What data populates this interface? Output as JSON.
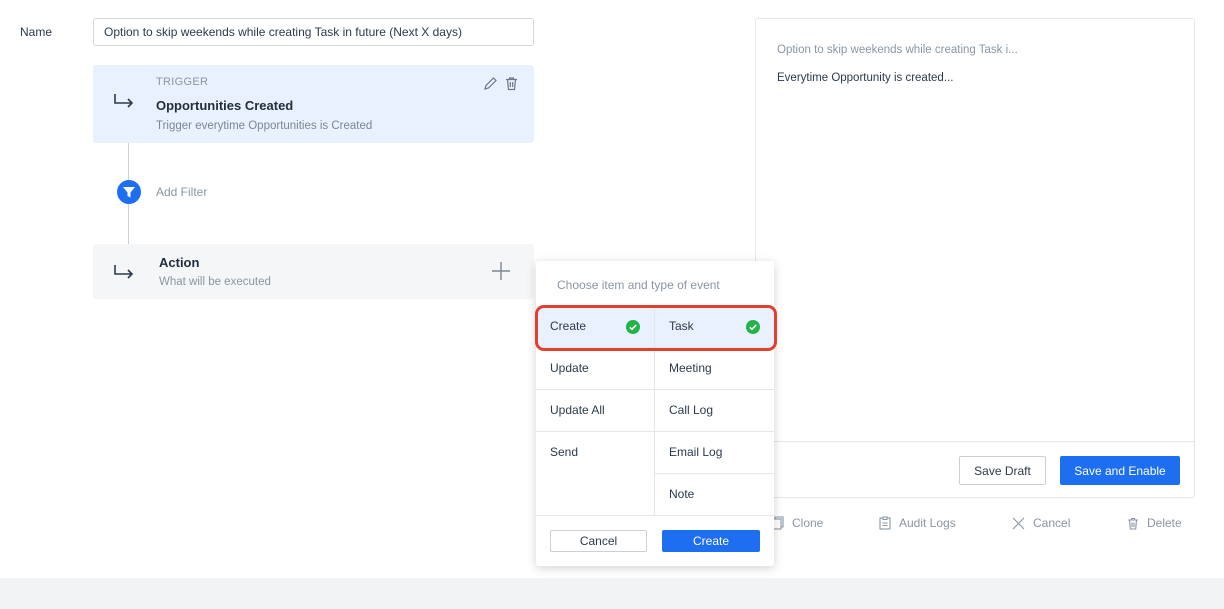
{
  "form": {
    "name_label": "Name",
    "name_value": "Option to skip weekends while creating Task in future (Next X days)"
  },
  "trigger": {
    "kicker": "TRIGGER",
    "title": "Opportunities Created",
    "subtitle": "Trigger everytime Opportunities is Created"
  },
  "filter": {
    "label": "Add Filter"
  },
  "action": {
    "title": "Action",
    "subtitle": "What will be executed"
  },
  "preview": {
    "title": "Option to skip weekends while creating Task i...",
    "description": "Everytime Opportunity is created...",
    "save_draft_label": "Save Draft",
    "save_enable_label": "Save and Enable"
  },
  "footer_actions": {
    "clone": "Clone",
    "audit_logs": "Audit Logs",
    "cancel": "Cancel",
    "delete": "Delete"
  },
  "event_picker": {
    "header": "Choose item and type of event",
    "event_types": [
      {
        "label": "Create",
        "selected": true
      },
      {
        "label": "Update",
        "selected": false
      },
      {
        "label": "Update All",
        "selected": false
      },
      {
        "label": "Send",
        "selected": false
      }
    ],
    "items": [
      {
        "label": "Task",
        "selected": true
      },
      {
        "label": "Meeting",
        "selected": false
      },
      {
        "label": "Call Log",
        "selected": false
      },
      {
        "label": "Email Log",
        "selected": false
      },
      {
        "label": "Note",
        "selected": false
      }
    ],
    "cancel_label": "Cancel",
    "create_label": "Create"
  },
  "colors": {
    "primary": "#1d6ef0",
    "check_green": "#22b34a",
    "highlight_red": "#e2402f",
    "trigger_bg": "#e8f1fd"
  }
}
